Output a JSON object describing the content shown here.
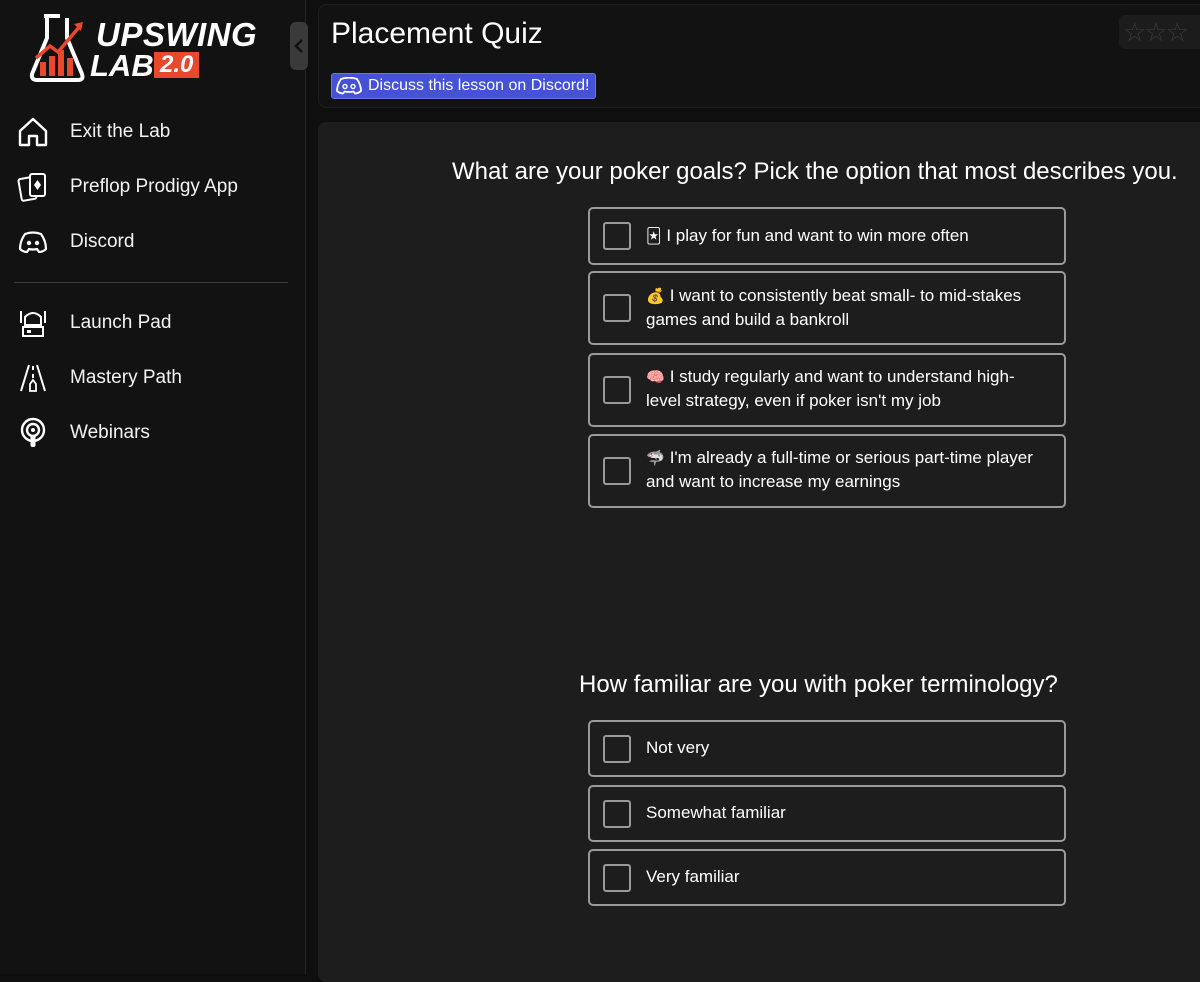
{
  "logo": {
    "word1": "UPSWING",
    "word2": "LAB",
    "version": "2.0"
  },
  "sidebar": {
    "items": [
      {
        "label": "Exit the Lab",
        "icon": "home-icon"
      },
      {
        "label": "Preflop Prodigy App",
        "icon": "cards-icon"
      },
      {
        "label": "Discord",
        "icon": "discord-icon"
      },
      {
        "label": "Launch Pad",
        "icon": "launch-pad-icon"
      },
      {
        "label": "Mastery Path",
        "icon": "road-icon"
      },
      {
        "label": "Webinars",
        "icon": "podcast-icon"
      }
    ]
  },
  "header": {
    "title": "Placement Quiz",
    "discord_label": "Discuss this lesson on Discord!"
  },
  "quiz": {
    "q1": {
      "question": "What are your poker goals? Pick the option that most describes you.",
      "options": [
        {
          "emoji": "🃏",
          "text": "I play for fun and want to win more often"
        },
        {
          "emoji": "💰",
          "text": "I want to consistently beat small- to mid-stakes games and build a bankroll"
        },
        {
          "emoji": "🧠",
          "text": "I study regularly and want to understand high-level strategy, even if poker isn't my job"
        },
        {
          "emoji": "🦈",
          "text": "I'm already a full-time or serious part-time player and want to increase my earnings"
        }
      ]
    },
    "q2": {
      "question": "How familiar are you with poker terminology?",
      "options": [
        {
          "text": "Not very"
        },
        {
          "text": "Somewhat familiar"
        },
        {
          "text": "Very familiar"
        }
      ]
    }
  },
  "colors": {
    "accent_discord": "#4552d6",
    "logo_orange": "#e8482b",
    "background": "#0f0f0f",
    "panel": "#1d1d1d"
  }
}
